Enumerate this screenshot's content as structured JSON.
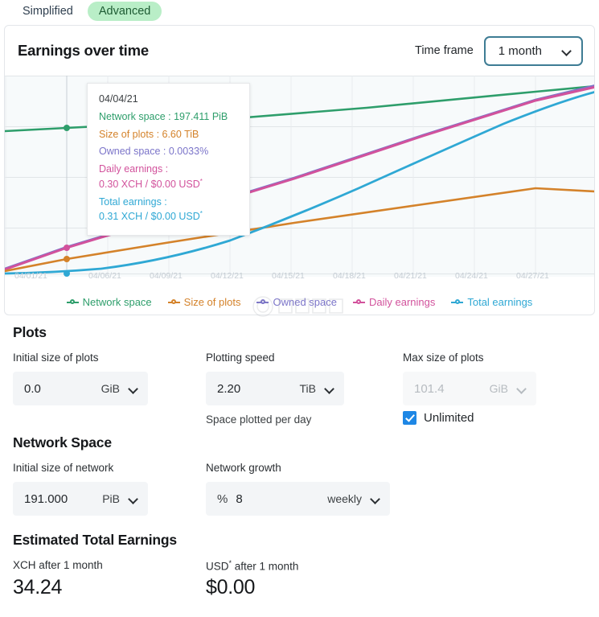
{
  "tabs": [
    {
      "label": "Simplified",
      "active": false
    },
    {
      "label": "Advanced",
      "active": true
    }
  ],
  "card": {
    "title": "Earnings over time",
    "time_frame_label": "Time frame",
    "time_frame_value": "1 month"
  },
  "tooltip": {
    "date": "04/04/21",
    "rows": [
      {
        "text": "Network space : 197.411 PiB",
        "color": "#2e9e6b"
      },
      {
        "text": "Size of plots : 6.60 TiB",
        "color": "#d4822a"
      },
      {
        "text": "Owned space : 0.0033%",
        "color": "#7b74c9"
      },
      {
        "label": "Daily earnings :",
        "value": "0.30 XCH / $0.00 USD",
        "sup": "*",
        "color": "#d2529c"
      },
      {
        "label": "Total earnings :",
        "value": "0.31 XCH / $0.00 USD",
        "sup": "*",
        "color": "#2fa8d4"
      }
    ]
  },
  "legend": [
    {
      "label": "Network space",
      "color": "#2e9e6b"
    },
    {
      "label": "Size of plots",
      "color": "#d4822a"
    },
    {
      "label": "Owned space",
      "color": "#7b74c9"
    },
    {
      "label": "Daily earnings",
      "color": "#d2529c"
    },
    {
      "label": "Total earnings",
      "color": "#2fa8d4"
    }
  ],
  "plots": {
    "section_title": "Plots",
    "initial_size_label": "Initial size of plots",
    "initial_size_value": "0.0",
    "initial_size_unit": "GiB",
    "plotting_speed_label": "Plotting speed",
    "plotting_speed_value": "2.20",
    "plotting_speed_unit": "TiB",
    "plotting_speed_hint": "Space plotted per day",
    "max_size_label": "Max size of plots",
    "max_size_value": "101.4",
    "max_size_unit": "GiB",
    "unlimited_label": "Unlimited"
  },
  "network_space": {
    "section_title": "Network Space",
    "initial_size_label": "Initial size of network",
    "initial_size_value": "191.000",
    "initial_size_unit": "PiB",
    "growth_label": "Network growth",
    "growth_prefix": "%",
    "growth_value": "8",
    "growth_period": "weekly"
  },
  "earnings": {
    "section_title": "Estimated Total Earnings",
    "xch_label": "XCH after 1 month",
    "xch_value": "34.24",
    "usd_label_pre": "USD",
    "usd_label_sup": "*",
    "usd_label_post": " after 1 month",
    "usd_value": "$0.00"
  },
  "chart_data": {
    "type": "line",
    "title": "Earnings over time",
    "xlabel": "",
    "ylabel": "",
    "grid": true,
    "legend_position": "bottom",
    "x_tick_labels": [
      "04/01/21",
      "04/06/21",
      "04/09/21",
      "04/12/21",
      "04/15/21",
      "04/18/21",
      "04/21/21",
      "04/24/21",
      "04/27/21"
    ],
    "hover_x": "04/04/21",
    "series": [
      {
        "name": "Network space",
        "color": "#2e9e6b",
        "unit": "PiB",
        "hover_value": "197.411",
        "values": [
          191.0,
          193.1,
          195.3,
          197.4,
          199.6,
          201.9,
          204.2,
          206.5,
          208.9,
          211.3,
          213.7,
          216.2,
          218.8,
          221.3,
          223.9,
          226.6,
          229.3,
          232.0,
          234.8,
          237.6,
          240.5,
          243.4,
          246.3,
          249.3,
          252.4,
          255.5,
          258.6,
          261.8,
          265.0,
          268.3
        ]
      },
      {
        "name": "Size of plots",
        "color": "#d4822a",
        "unit": "TiB",
        "hover_value": "6.60",
        "values": [
          0.0,
          2.2,
          4.4,
          6.6,
          8.8,
          11.0,
          13.2,
          15.4,
          17.6,
          19.8,
          22.0,
          24.2,
          26.4,
          28.6,
          30.8,
          33.0,
          35.2,
          37.4,
          39.6,
          41.8,
          44.0,
          46.2,
          48.4,
          50.6,
          52.8,
          55.0,
          57.2,
          59.4,
          61.6,
          63.8
        ]
      },
      {
        "name": "Owned space",
        "color": "#7b74c9",
        "unit": "%",
        "hover_value": "0.0033",
        "values": [
          0.0,
          0.0011,
          0.0022,
          0.0033,
          0.0044,
          0.0055,
          0.0065,
          0.0076,
          0.0086,
          0.0096,
          0.0106,
          0.0116,
          0.0126,
          0.0135,
          0.0145,
          0.0154,
          0.0163,
          0.0172,
          0.0181,
          0.019,
          0.0199,
          0.0207,
          0.0216,
          0.0224,
          0.0232,
          0.024,
          0.0248,
          0.0256,
          0.0264,
          0.0271
        ]
      },
      {
        "name": "Daily earnings",
        "color": "#d2529c",
        "unit": "XCH",
        "hover_value": "0.30",
        "values": [
          0.0,
          0.1,
          0.2,
          0.3,
          0.4,
          0.5,
          0.6,
          0.7,
          0.79,
          0.88,
          0.97,
          1.06,
          1.15,
          1.24,
          1.32,
          1.41,
          1.49,
          1.57,
          1.65,
          1.73,
          1.81,
          1.89,
          1.97,
          2.04,
          2.12,
          2.19,
          2.26,
          2.34,
          2.41,
          2.48
        ]
      },
      {
        "name": "Total earnings",
        "color": "#2fa8d4",
        "unit": "XCH",
        "hover_value": "0.31",
        "values": [
          0.0,
          0.1,
          0.2,
          0.31,
          0.6,
          1.0,
          1.5,
          2.1,
          2.8,
          3.6,
          4.5,
          5.5,
          6.6,
          7.8,
          9.1,
          10.5,
          12.0,
          13.6,
          15.3,
          17.1,
          19.0,
          21.0,
          23.1,
          25.3,
          27.6,
          30.0,
          32.5,
          35.1,
          37.8,
          40.6
        ]
      }
    ]
  }
}
